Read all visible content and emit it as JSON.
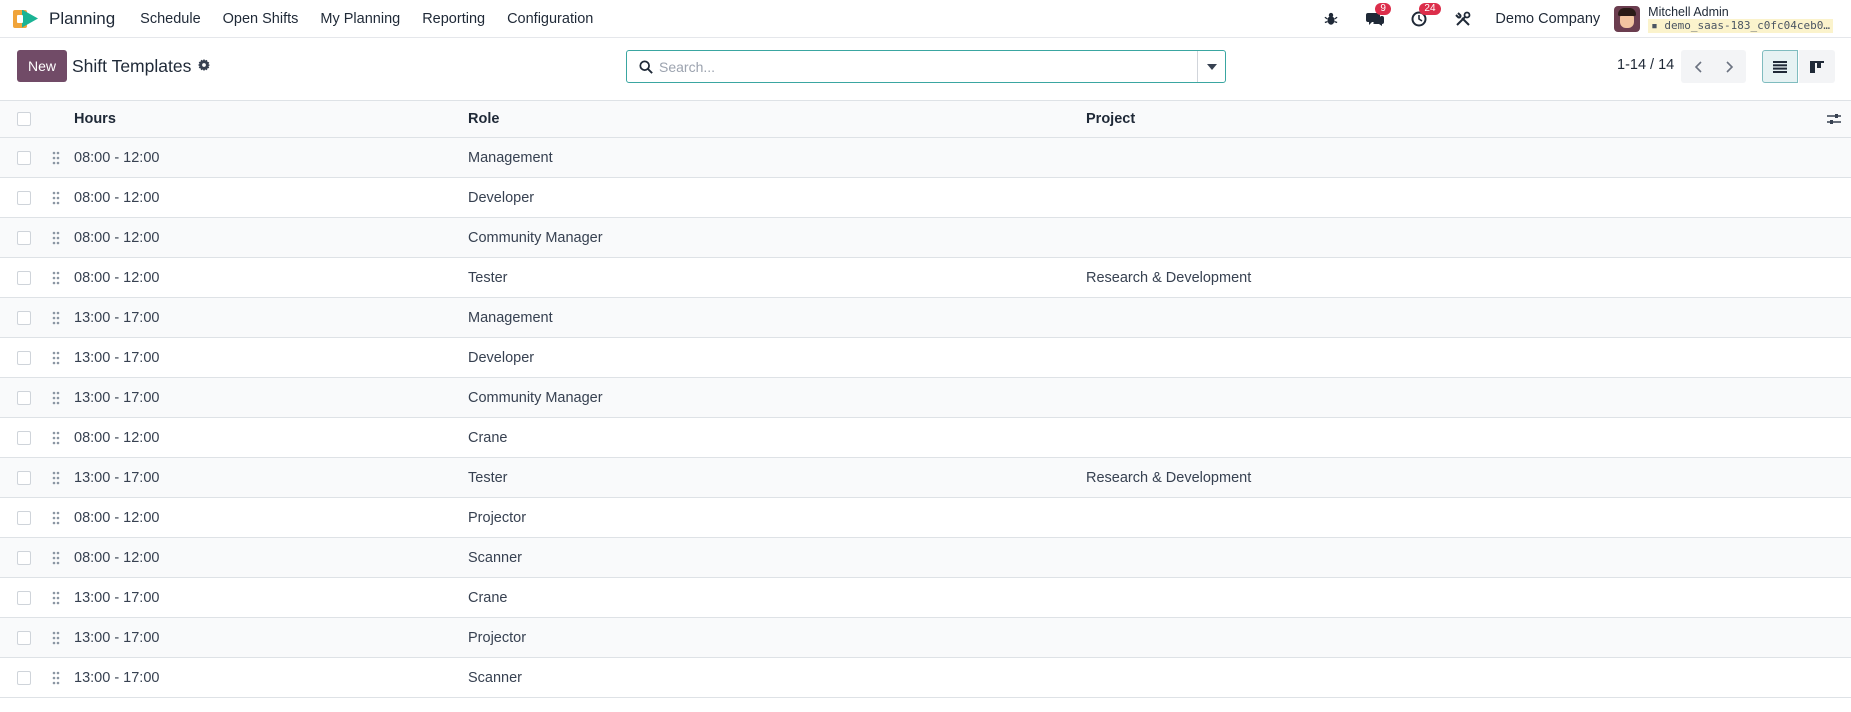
{
  "navbar": {
    "app_name": "Planning",
    "menu": [
      "Schedule",
      "Open Shifts",
      "My Planning",
      "Reporting",
      "Configuration"
    ],
    "messages_badge": "9",
    "activities_badge": "24",
    "company": "Demo Company",
    "user_name": "Mitchell Admin",
    "db_name": "demo_saas-183_c0fc04ceb0…",
    "icons": [
      "bug-icon",
      "chat-icon",
      "clock-icon",
      "tools-icon"
    ]
  },
  "control_panel": {
    "new_label": "New",
    "title": "Shift Templates",
    "search_placeholder": "Search...",
    "pager": "1-14 / 14"
  },
  "table": {
    "headers": {
      "hours": "Hours",
      "role": "Role",
      "project": "Project"
    },
    "rows": [
      {
        "hours": "08:00 - 12:00",
        "role": "Management",
        "project": ""
      },
      {
        "hours": "08:00 - 12:00",
        "role": "Developer",
        "project": ""
      },
      {
        "hours": "08:00 - 12:00",
        "role": "Community Manager",
        "project": ""
      },
      {
        "hours": "08:00 - 12:00",
        "role": "Tester",
        "project": "Research & Development"
      },
      {
        "hours": "13:00 - 17:00",
        "role": "Management",
        "project": ""
      },
      {
        "hours": "13:00 - 17:00",
        "role": "Developer",
        "project": ""
      },
      {
        "hours": "13:00 - 17:00",
        "role": "Community Manager",
        "project": ""
      },
      {
        "hours": "08:00 - 12:00",
        "role": "Crane",
        "project": ""
      },
      {
        "hours": "13:00 - 17:00",
        "role": "Tester",
        "project": "Research & Development"
      },
      {
        "hours": "08:00 - 12:00",
        "role": "Projector",
        "project": ""
      },
      {
        "hours": "08:00 - 12:00",
        "role": "Scanner",
        "project": ""
      },
      {
        "hours": "13:00 - 17:00",
        "role": "Crane",
        "project": ""
      },
      {
        "hours": "13:00 - 17:00",
        "role": "Projector",
        "project": ""
      },
      {
        "hours": "13:00 - 17:00",
        "role": "Scanner",
        "project": ""
      }
    ]
  },
  "colors": {
    "brand": "#714b67",
    "accent": "#3aa6a1",
    "badge": "#dc2e4b"
  }
}
